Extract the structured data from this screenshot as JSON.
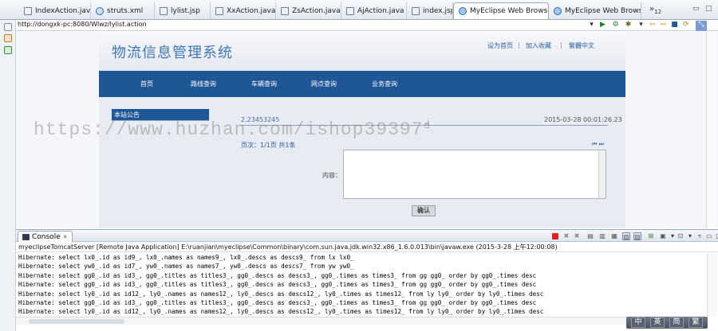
{
  "editor_tabs": [
    {
      "label": "IndexAction.java",
      "icon": "java-file-icon"
    },
    {
      "label": "struts.xml",
      "icon": "struts-icon"
    },
    {
      "label": "lylist.jsp",
      "icon": "jsp-file-icon"
    },
    {
      "label": "XxAction.java",
      "icon": "java-file-icon"
    },
    {
      "label": "ZsAction.java",
      "icon": "java-file-icon"
    },
    {
      "label": "AjAction.java",
      "icon": "java-file-icon"
    },
    {
      "label": "index.jsp",
      "icon": "jsp-file-icon"
    },
    {
      "label": "MyEclipse Web Browse",
      "icon": "globe-icon",
      "close": "✕"
    },
    {
      "label": "MyEclipse Web Browse",
      "icon": "globe-icon"
    }
  ],
  "tab_overflow": "»",
  "tab_overflow_count": "12",
  "browser": {
    "url": "http://dongxk-pc:8080/Wlwz/lylist.action"
  },
  "site": {
    "title": "物流信息管理系统",
    "top_links": [
      "设为首页",
      "加入收藏",
      "繁體中文"
    ],
    "nav": [
      "首页",
      "路线查询",
      "车辆查询",
      "网点查询",
      "业务查询"
    ],
    "notice_label": "本站公告",
    "news_title": "2.23453245",
    "news_date": "2015-03-28 00:01:26.23",
    "pager": "页次：1/1页   共1条",
    "pager_arrows": "⏮ ⏭",
    "content_label": "内容：",
    "submit_label": "确认"
  },
  "watermark": "https://www.huzhan.com/ishop39397",
  "console": {
    "tab_label": "Console",
    "header": "myeclipseTomcatServer [Remote Java Application] E:\\ruanjian\\myeclipse\\Common\\binary\\com.sun.java.jdk.win32.x86_1.6.0.013\\bin\\javaw.exe (2015-3-28 上午12:00:08)",
    "lines": [
      "Hibernate: select lx0_.id as id9_, lx0_.names as names9_, lx0_.descs as descs9_ from lx lx0_",
      "Hibernate: select yw0_.id as id7_, yw0_.names as names7_, yw0_.descs as descs7_ from yw yw0_",
      "Hibernate: select gg0_.id as id3_, gg0_.titles as titles3_, gg0_.descs as descs3_, gg0_.times as times3_ from gg gg0_ order by gg0_.times desc",
      "Hibernate: select gg0_.id as id3_, gg0_.titles as titles3_, gg0_.descs as descs3_, gg0_.times as times3_ from gg gg0_ order by gg0_.times desc",
      "Hibernate: select ly0_.id as id12_, ly0_.names as names12_, ly0_.descs as descs12_, ly0_.times as times12_ from ly ly0_ order by ly0_.times desc",
      "Hibernate: select gg0_.id as id3_, gg0_.titles as titles3_, gg0_.descs as descs3_, gg0_.times as times3_ from gg gg0_ order by gg0_.times desc",
      "Hibernate: select ly0_.id as id12_, ly0_.names as names12_, ly0_.descs as descs12_, ly0_.times as times12_ from ly ly0_ order by ly0_.times desc"
    ]
  },
  "ime_bar": [
    "中",
    "英",
    "简",
    "繁"
  ]
}
